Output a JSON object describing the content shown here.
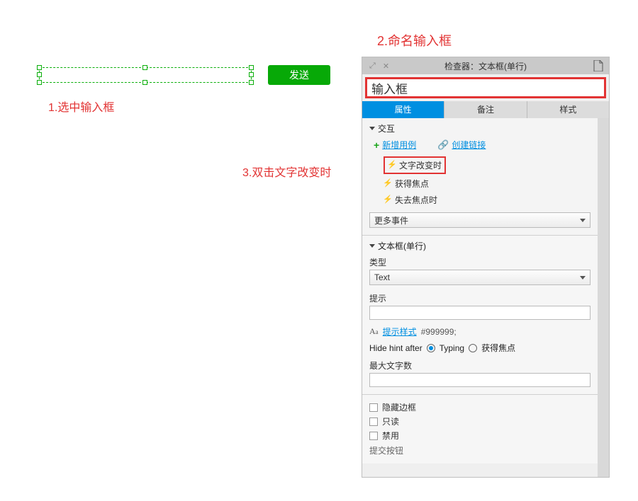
{
  "canvas": {
    "send_button_label": "发送"
  },
  "annotations": {
    "step1": "1.选中输入框",
    "step2": "2.命名输入框",
    "step3": "3.双击文字改变时"
  },
  "inspector": {
    "header": {
      "collapse_icon": "expand-icon",
      "close_icon": "close-icon",
      "title": "检查器：文本框(单行)",
      "doc_icon": "document-icon"
    },
    "name_input_value": "输入框",
    "tabs": {
      "properties": "属性",
      "notes": "备注",
      "style": "样式"
    },
    "interaction_section": {
      "title": "交互",
      "add_case_label": "新增用例",
      "create_link_label": "创建链接",
      "events": [
        {
          "label": "文字改变时"
        },
        {
          "label": "获得焦点"
        },
        {
          "label": "失去焦点时"
        }
      ],
      "more_events_select": "更多事件"
    },
    "textbox_section": {
      "title": "文本框(单行)",
      "type_label": "类型",
      "type_value": "Text",
      "hint_label": "提示",
      "hint_value": "",
      "hint_style_label": "提示样式",
      "hint_style_hex": "#999999;",
      "hide_hint_after_label": "Hide hint after",
      "radio_typing": "Typing",
      "radio_focus": "获得焦点",
      "max_chars_label": "最大文字数",
      "max_chars_value": "",
      "hide_border_label": "隐藏边框",
      "readonly_label": "只读",
      "disabled_label": "禁用",
      "cutoff_label": "提交按钮"
    }
  }
}
